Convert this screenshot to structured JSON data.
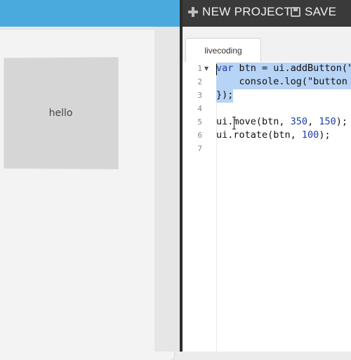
{
  "toolbar": {
    "new_project_label": "NEW PROJECT",
    "save_label": "SAVE"
  },
  "preview": {
    "button_label": "hello"
  },
  "editor": {
    "tab_label": "livecoding",
    "line_numbers": [
      "1",
      "2",
      "3",
      "4",
      "5",
      "6",
      "7"
    ],
    "lines": [
      {
        "parts": [
          {
            "t": "var",
            "c": "kw"
          },
          {
            "t": " btn = ui.addButton(\""
          }
        ]
      },
      {
        "parts": [
          {
            "t": "    console.log(\"button "
          }
        ]
      },
      {
        "parts": [
          {
            "t": "});"
          }
        ]
      },
      {
        "parts": [
          {
            "t": ""
          }
        ]
      },
      {
        "parts": [
          {
            "t": "ui.move(btn, "
          },
          {
            "t": "350",
            "c": "num"
          },
          {
            "t": ", "
          },
          {
            "t": "150",
            "c": "num"
          },
          {
            "t": ");"
          }
        ]
      },
      {
        "parts": [
          {
            "t": "ui.rotate(btn, "
          },
          {
            "t": "100",
            "c": "num"
          },
          {
            "t": ");"
          }
        ]
      },
      {
        "parts": [
          {
            "t": ""
          }
        ]
      }
    ]
  },
  "colors": {
    "topbar_blue": "#4aa9dd",
    "toolbar_dark": "#3a3a3a",
    "selection": "#b7d3f5",
    "keyword": "#1f3fa8"
  }
}
